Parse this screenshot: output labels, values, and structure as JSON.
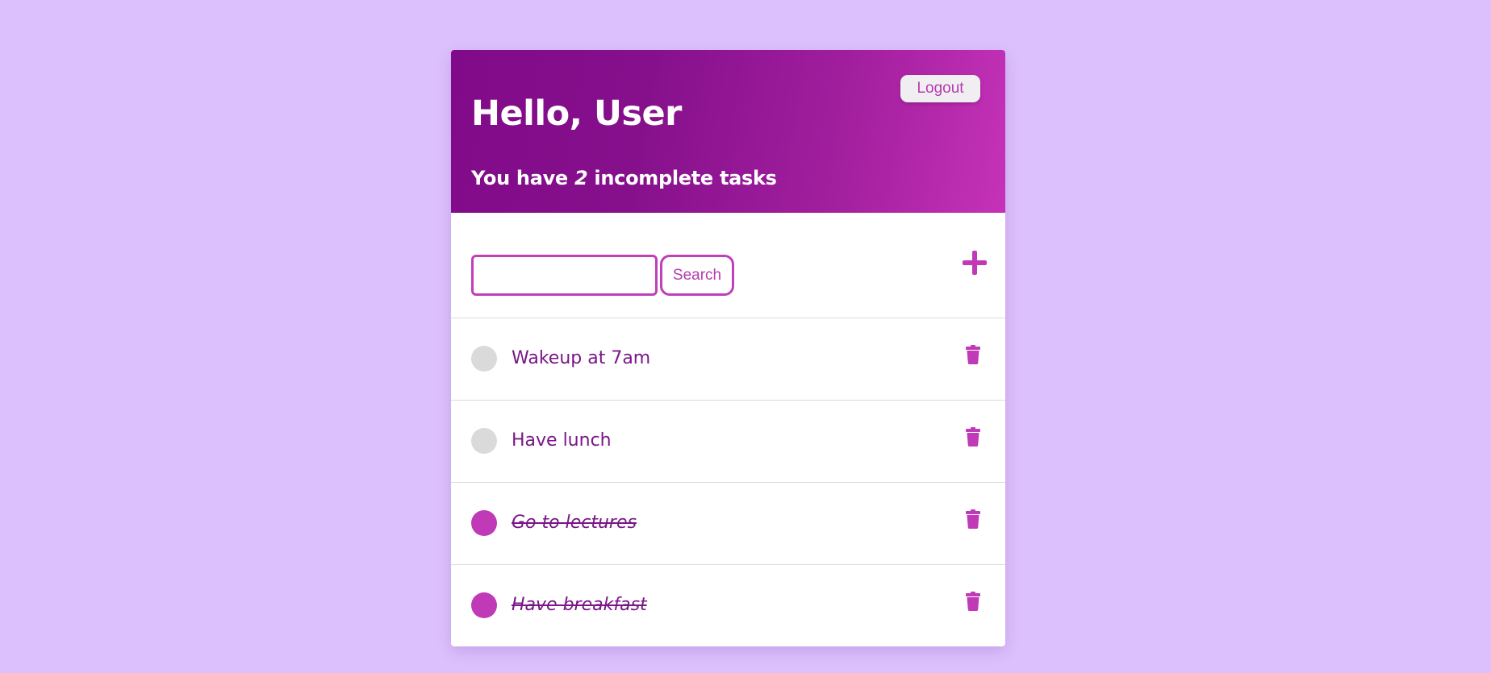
{
  "header": {
    "greeting": "Hello, User",
    "summary_prefix": "You have ",
    "incomplete_count": "2",
    "summary_suffix": " incomplete tasks",
    "logout_label": "Logout"
  },
  "toolbar": {
    "search_value": "",
    "search_placeholder": "",
    "search_label": "Search",
    "add_icon": "plus-icon"
  },
  "tasks": [
    {
      "text": "Wakeup at 7am",
      "completed": false
    },
    {
      "text": "Have lunch",
      "completed": false
    },
    {
      "text": "Go to lectures",
      "completed": true
    },
    {
      "text": "Have breakfast",
      "completed": true
    }
  ],
  "colors": {
    "background": "#dcc0fd",
    "accent": "#c039b6",
    "header_start": "#800a88",
    "header_end": "#c532b8",
    "task_text": "#7a1688",
    "incomplete_toggle": "#dadada"
  }
}
